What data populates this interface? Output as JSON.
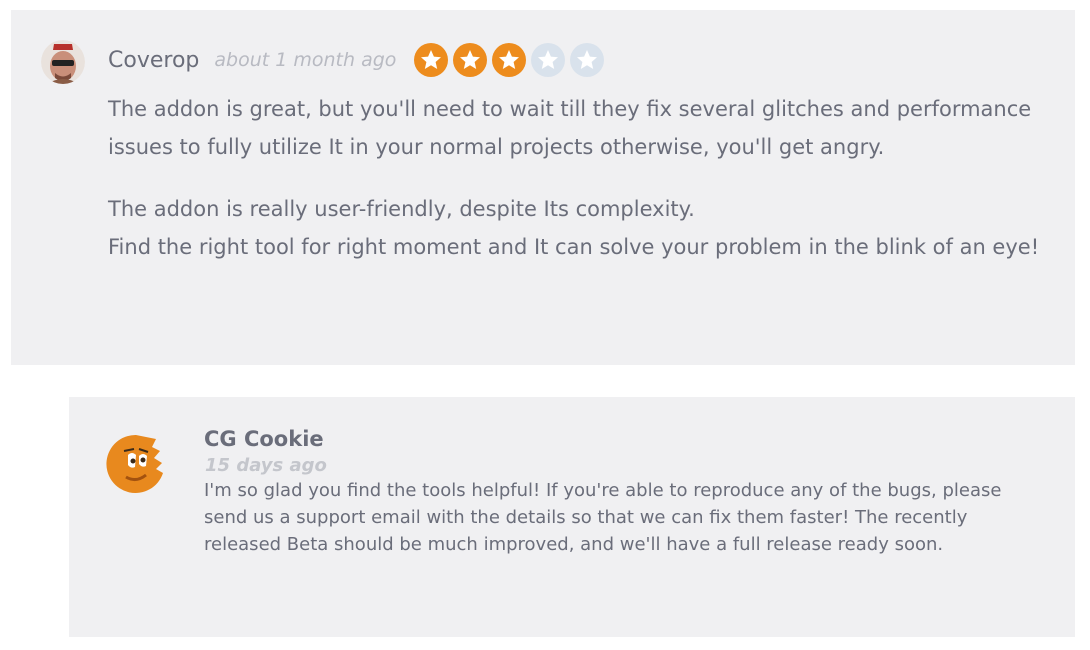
{
  "review": {
    "author": "Coverop",
    "time": "about 1 month ago",
    "rating": 3,
    "rating_max": 5,
    "paragraphs": [
      "The addon is great, but you'll need to wait till they fix several glitches and performance issues to fully utilize It in your normal projects otherwise, you'll get angry.",
      "The addon is really user-friendly, despite Its complexity.",
      "Find the right tool for right moment and It can solve your problem in the blink of an eye!"
    ]
  },
  "reply": {
    "author": "CG Cookie",
    "time": "15 days ago",
    "text": "I'm so glad you find the tools helpful! If you're able to reproduce any of the bugs, please send us a support email with the details so that we can fix them faster! The recently released Beta should be much improved, and we'll have a full release ready soon."
  },
  "colors": {
    "star_on": "#ed8c1d",
    "star_off": "#d9e2ec",
    "panel_bg": "#f0f0f2",
    "text": "#6a6d7a"
  },
  "icons": {
    "reviewer_avatar": "user-avatar-icon",
    "reply_avatar": "cg-cookie-logo-icon",
    "star": "star-icon"
  }
}
